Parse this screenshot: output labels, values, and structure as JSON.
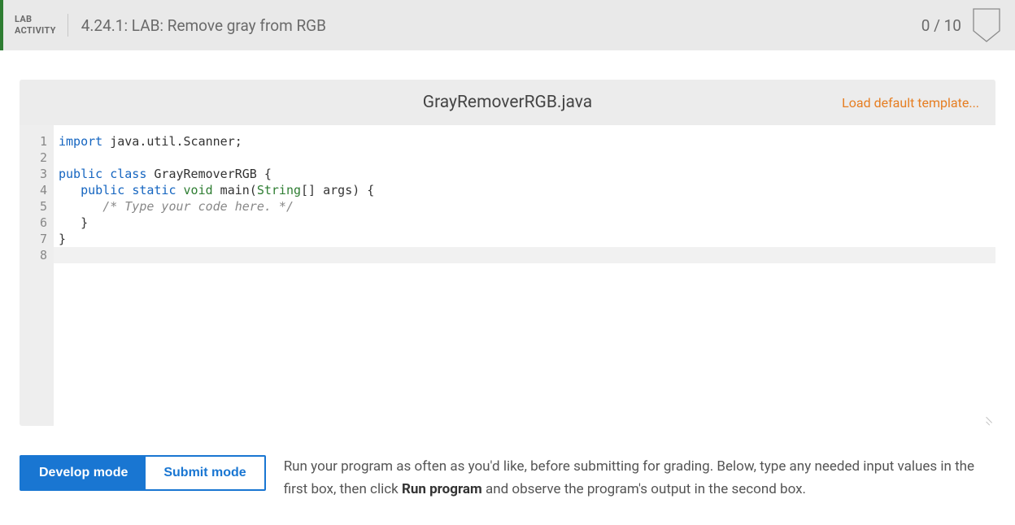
{
  "header": {
    "activity_label_line1": "LAB",
    "activity_label_line2": "ACTIVITY",
    "title": "4.24.1: LAB: Remove gray from RGB",
    "score": "0 / 10"
  },
  "editor": {
    "filename": "GrayRemoverRGB.java",
    "load_template_label": "Load default template...",
    "gutter": [
      "1",
      "2",
      "3",
      "4",
      "5",
      "6",
      "7",
      "8"
    ],
    "code_lines": [
      [
        {
          "t": "import",
          "c": "kw-blue"
        },
        {
          "t": " java.util.Scanner;",
          "c": "plain"
        }
      ],
      [],
      [
        {
          "t": "public",
          "c": "kw-blue"
        },
        {
          "t": " ",
          "c": "plain"
        },
        {
          "t": "class",
          "c": "kw-blue"
        },
        {
          "t": " ",
          "c": "plain"
        },
        {
          "t": "GrayRemoverRGB",
          "c": "plain"
        },
        {
          "t": " {",
          "c": "plain"
        }
      ],
      [
        {
          "t": "   ",
          "c": "plain"
        },
        {
          "t": "public",
          "c": "kw-blue"
        },
        {
          "t": " ",
          "c": "plain"
        },
        {
          "t": "static",
          "c": "kw-blue"
        },
        {
          "t": " ",
          "c": "plain"
        },
        {
          "t": "void",
          "c": "kw-green"
        },
        {
          "t": " main(",
          "c": "plain"
        },
        {
          "t": "String",
          "c": "kw-type"
        },
        {
          "t": "[] args) {",
          "c": "plain"
        }
      ],
      [
        {
          "t": "      ",
          "c": "plain"
        },
        {
          "t": "/* Type your code here. */",
          "c": "comment"
        }
      ],
      [
        {
          "t": "   }",
          "c": "plain"
        }
      ],
      [
        {
          "t": "}",
          "c": "plain"
        }
      ],
      []
    ],
    "highlight_line_index": 7
  },
  "modes": {
    "develop_label": "Develop mode",
    "submit_label": "Submit mode",
    "active": "develop"
  },
  "instructions": {
    "text_before": "Run your program as often as you'd like, before submitting for grading. Below, type any needed input values in the first box, then click ",
    "bold": "Run program",
    "text_after": " and observe the program's output in the second box."
  }
}
